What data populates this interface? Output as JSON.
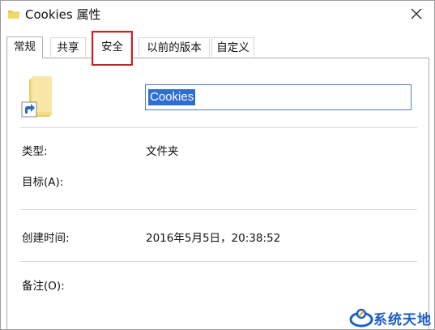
{
  "window": {
    "title": "Cookies 属性",
    "close_label": "✕"
  },
  "tabs": [
    {
      "label": "常规",
      "active": true
    },
    {
      "label": "共享",
      "active": false
    },
    {
      "label": "安全",
      "active": false,
      "highlighted": true
    },
    {
      "label": "以前的版本",
      "active": false
    },
    {
      "label": "自定义",
      "active": false
    }
  ],
  "general": {
    "name_value": "Cookies",
    "type_label": "类型:",
    "type_value": "文件夹",
    "target_label": "目标(A):",
    "created_label": "创建时间:",
    "created_value": "2016年5月5日，20:38:52",
    "comment_label": "备注(O):"
  },
  "watermark": {
    "text": "系统天地"
  },
  "colors": {
    "highlight_box": "#cf2020",
    "selection": "#2f6fd1",
    "watermark": "#1f5fbf"
  },
  "icons": {
    "title": "folder-icon",
    "close": "close-icon",
    "main": "folder-shortcut-icon"
  }
}
